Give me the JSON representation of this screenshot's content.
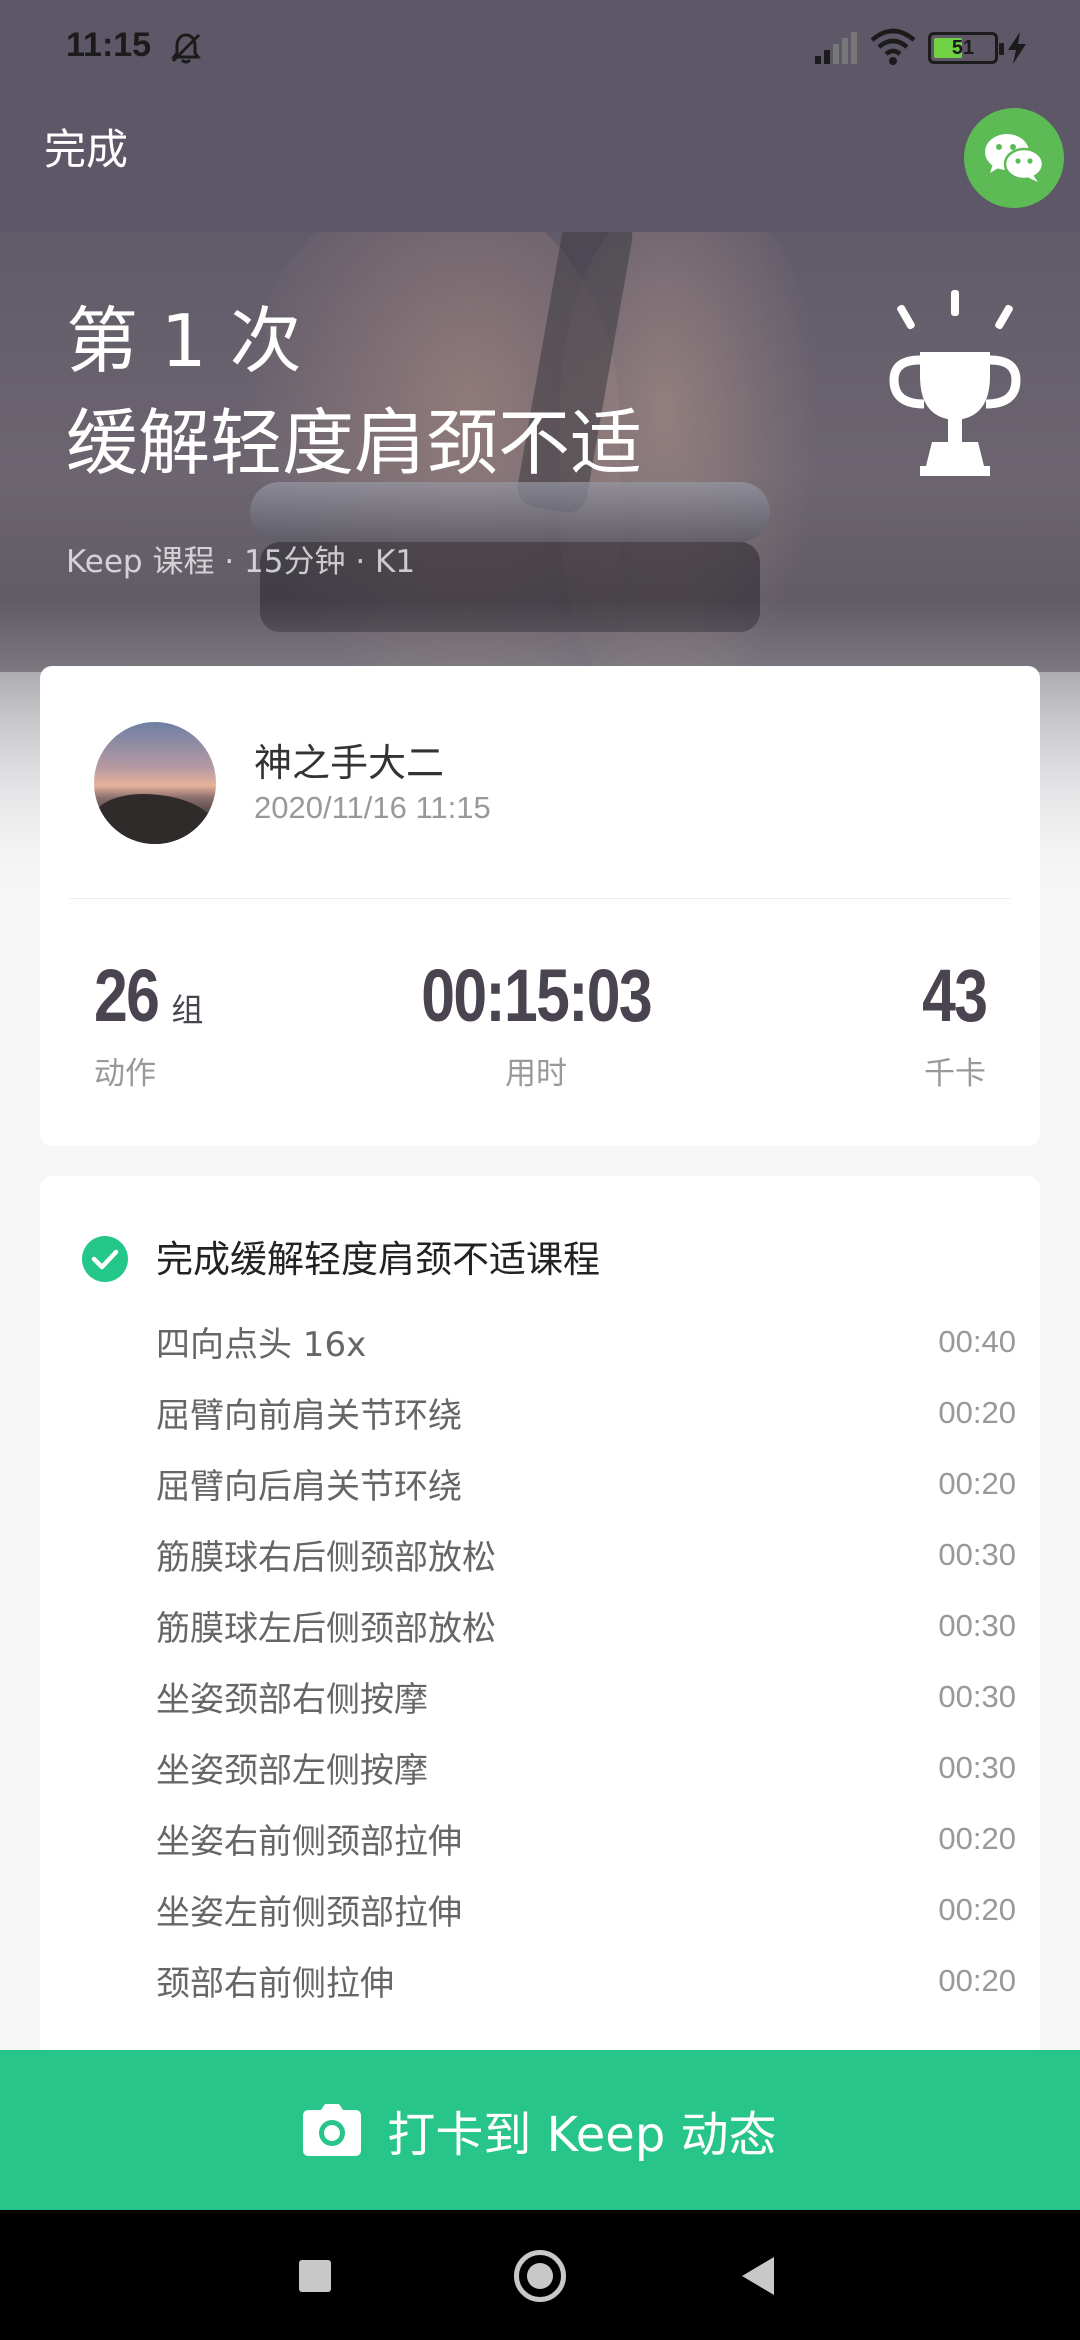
{
  "status_bar": {
    "time": "11:15",
    "battery": "51",
    "icons": [
      "mute-icon",
      "signal-icon",
      "wifi-icon",
      "battery-icon",
      "charging-icon"
    ]
  },
  "header": {
    "done_label": "完成",
    "share_icon": "wechat-icon"
  },
  "hero": {
    "count": "第 1 次",
    "title": "缓解轻度肩颈不适",
    "meta": "Keep 课程 · 15分钟 · K1",
    "badge_icon": "trophy-icon"
  },
  "user": {
    "name": "神之手大二",
    "datetime": "2020/11/16 11:15"
  },
  "stats": {
    "actions": {
      "value": "26",
      "unit": "组",
      "label": "动作"
    },
    "duration": {
      "value": "00:15:03",
      "label": "用时"
    },
    "calories": {
      "value": "43",
      "label": "千卡"
    }
  },
  "course": {
    "title": "完成缓解轻度肩颈不适课程",
    "exercises": [
      {
        "name": "四向点头 16x",
        "time": "00:40"
      },
      {
        "name": "屈臂向前肩关节环绕",
        "time": "00:20"
      },
      {
        "name": "屈臂向后肩关节环绕",
        "time": "00:20"
      },
      {
        "name": "筋膜球右后侧颈部放松",
        "time": "00:30"
      },
      {
        "name": "筋膜球左后侧颈部放松",
        "time": "00:30"
      },
      {
        "name": "坐姿颈部右侧按摩",
        "time": "00:30"
      },
      {
        "name": "坐姿颈部左侧按摩",
        "time": "00:30"
      },
      {
        "name": "坐姿右前侧颈部拉伸",
        "time": "00:20"
      },
      {
        "name": "坐姿左前侧颈部拉伸",
        "time": "00:20"
      },
      {
        "name": "颈部右前侧拉伸",
        "time": "00:20"
      }
    ]
  },
  "cta": {
    "label": "打卡到 Keep 动态",
    "icon": "camera-icon"
  },
  "colors": {
    "accent_green": "#28c58a",
    "check_green": "#24c789",
    "wechat_green": "#5dbb55",
    "header_purple": "#5d5767"
  }
}
